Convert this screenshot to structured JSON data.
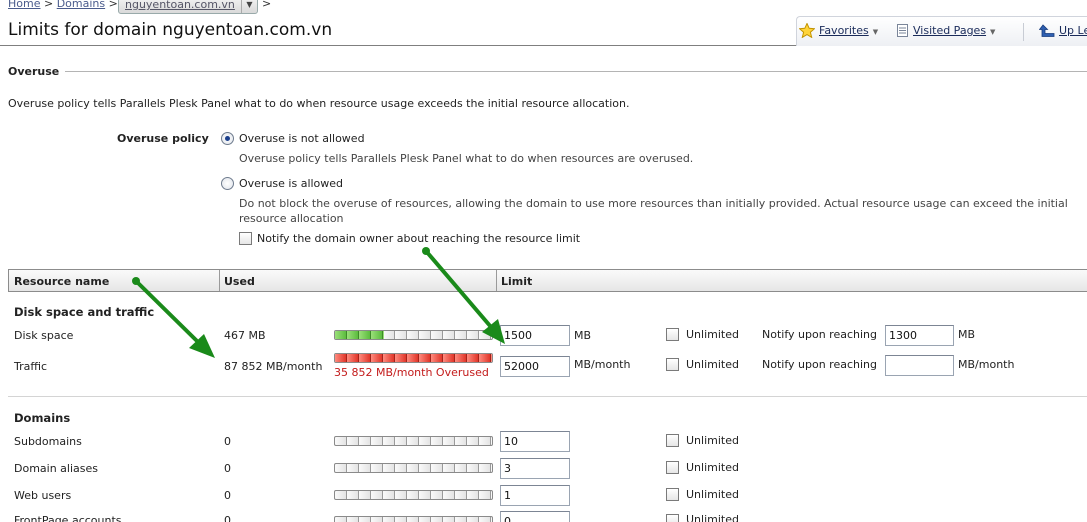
{
  "breadcrumb": {
    "home": "Home",
    "sep1": ">",
    "domains": "Domains",
    "sep2": ">",
    "current": "nguyentoan.com.vn",
    "sep3": ">"
  },
  "page": {
    "title": "Limits for domain nguyentoan.com.vn"
  },
  "toolbar": {
    "favorites": "Favorites",
    "visited": "Visited Pages",
    "up_level": "Up Level"
  },
  "overuse": {
    "legend": "Overuse",
    "description": "Overuse policy tells Parallels Plesk Panel what to do when resource usage exceeds the initial resource allocation.",
    "policy_label": "Overuse policy",
    "option_not_allowed": "Overuse is not allowed",
    "option_not_allowed_desc": "Overuse policy tells Parallels Plesk Panel what to do when resources are overused.",
    "option_allowed": "Overuse is allowed",
    "option_allowed_desc_1": "Do not block the overuse of resources, allowing the domain to use more resources than initially provided. Actual resource usage can exceed the initial",
    "option_allowed_desc_2": "resource allocation",
    "notify_owner": "Notify the domain owner about reaching the resource limit",
    "selected": "Overuse is not allowed"
  },
  "table": {
    "headers": [
      "Resource name",
      "Used",
      "Limit"
    ],
    "groups": [
      {
        "title": "Disk space and traffic",
        "rows": [
          {
            "name": "Disk space",
            "used": "467 MB",
            "usage_fraction": 0.31,
            "bar_color": "green",
            "limit": "1500",
            "unit": "MB",
            "unlimited_label": "Unlimited",
            "notify_label": "Notify upon reaching",
            "notify_value": "1300",
            "notify_unit": "MB"
          },
          {
            "name": "Traffic",
            "used": "87 852 MB/month",
            "usage_fraction": 1.0,
            "bar_color": "red",
            "note": "35 852 MB/month Overused",
            "limit": "52000",
            "unit": "MB/month",
            "unlimited_label": "Unlimited",
            "notify_label": "Notify upon reaching",
            "notify_value": "",
            "notify_unit": "MB/month"
          }
        ]
      },
      {
        "title": "Domains",
        "rows": [
          {
            "name": "Subdomains",
            "used": "0",
            "usage_fraction": 0,
            "limit": "10",
            "unlimited_label": "Unlimited"
          },
          {
            "name": "Domain aliases",
            "used": "0",
            "usage_fraction": 0,
            "limit": "3",
            "unlimited_label": "Unlimited"
          },
          {
            "name": "Web users",
            "used": "0",
            "usage_fraction": 0,
            "limit": "1",
            "unlimited_label": "Unlimited"
          },
          {
            "name": "FrontPage accounts",
            "used": "0",
            "usage_fraction": 0,
            "limit": "0",
            "unlimited_label": "Unlimited"
          }
        ]
      }
    ]
  },
  "colors": {
    "annotation_arrow": "#1a8a1a",
    "overused_text": "#c31a1a",
    "link": "#1a3b7a"
  },
  "icons": {
    "favorites": "star-icon",
    "up_level": "up-arrow-icon"
  }
}
